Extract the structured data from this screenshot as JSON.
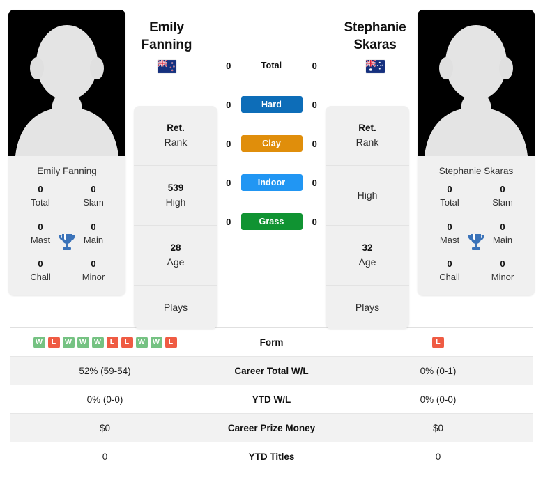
{
  "players": {
    "left": {
      "first_name": "Emily",
      "last_name": "Fanning",
      "full_name": "Emily Fanning",
      "flag": "new-zealand-flag",
      "rank": "Ret.",
      "rank_label": "Rank",
      "high": "539",
      "high_label": "High",
      "age": "28",
      "age_label": "Age",
      "plays_label": "Plays",
      "plays_value": "",
      "titles": {
        "total": "0",
        "total_label": "Total",
        "slam": "0",
        "slam_label": "Slam",
        "mast": "0",
        "mast_label": "Mast",
        "main": "0",
        "main_label": "Main",
        "chall": "0",
        "chall_label": "Chall",
        "minor": "0",
        "minor_label": "Minor"
      },
      "surface_counts": {
        "total": "0",
        "hard": "0",
        "clay": "0",
        "indoor": "0",
        "grass": "0"
      },
      "form": [
        "W",
        "L",
        "W",
        "W",
        "W",
        "L",
        "L",
        "W",
        "W",
        "L"
      ],
      "career_total_wl": "52% (59-54)",
      "ytd_wl": "0% (0-0)",
      "career_prize_money": "$0",
      "ytd_titles": "0"
    },
    "right": {
      "first_name": "Stephanie",
      "last_name": "Skaras",
      "full_name": "Stephanie Skaras",
      "flag": "australia-flag",
      "rank": "Ret.",
      "rank_label": "Rank",
      "high": "",
      "high_label": "High",
      "age": "32",
      "age_label": "Age",
      "plays_label": "Plays",
      "plays_value": "",
      "titles": {
        "total": "0",
        "total_label": "Total",
        "slam": "0",
        "slam_label": "Slam",
        "mast": "0",
        "mast_label": "Mast",
        "main": "0",
        "main_label": "Main",
        "chall": "0",
        "chall_label": "Chall",
        "minor": "0",
        "minor_label": "Minor"
      },
      "surface_counts": {
        "total": "0",
        "hard": "0",
        "clay": "0",
        "indoor": "0",
        "grass": "0"
      },
      "form": [
        "L"
      ],
      "career_total_wl": "0% (0-1)",
      "ytd_wl": "0% (0-0)",
      "career_prize_money": "$0",
      "ytd_titles": "0"
    }
  },
  "surfaces": [
    {
      "key": "total",
      "label": "Total",
      "color": "transparent",
      "plain": true
    },
    {
      "key": "hard",
      "label": "Hard",
      "color": "#0d6db8",
      "plain": false
    },
    {
      "key": "clay",
      "label": "Clay",
      "color": "#e08e0b",
      "plain": false
    },
    {
      "key": "indoor",
      "label": "Indoor",
      "color": "#2196f3",
      "plain": false
    },
    {
      "key": "grass",
      "label": "Grass",
      "color": "#109332",
      "plain": false
    }
  ],
  "stat_rows": [
    {
      "label": "Form",
      "type": "form"
    },
    {
      "label": "Career Total W/L",
      "type": "text",
      "key": "career_total_wl"
    },
    {
      "label": "YTD W/L",
      "type": "text",
      "key": "ytd_wl"
    },
    {
      "label": "Career Prize Money",
      "type": "text",
      "key": "career_prize_money"
    },
    {
      "label": "YTD Titles",
      "type": "text",
      "key": "ytd_titles"
    }
  ],
  "colors": {
    "win_badge": "#75c282",
    "loss_badge": "#ef5b43",
    "trophy": "#3b73b9",
    "card_bg": "#f0f0f0",
    "row_alt_bg": "#f2f2f2"
  },
  "icons": {
    "trophy": "trophy-icon",
    "avatar": "avatar-placeholder-icon"
  }
}
